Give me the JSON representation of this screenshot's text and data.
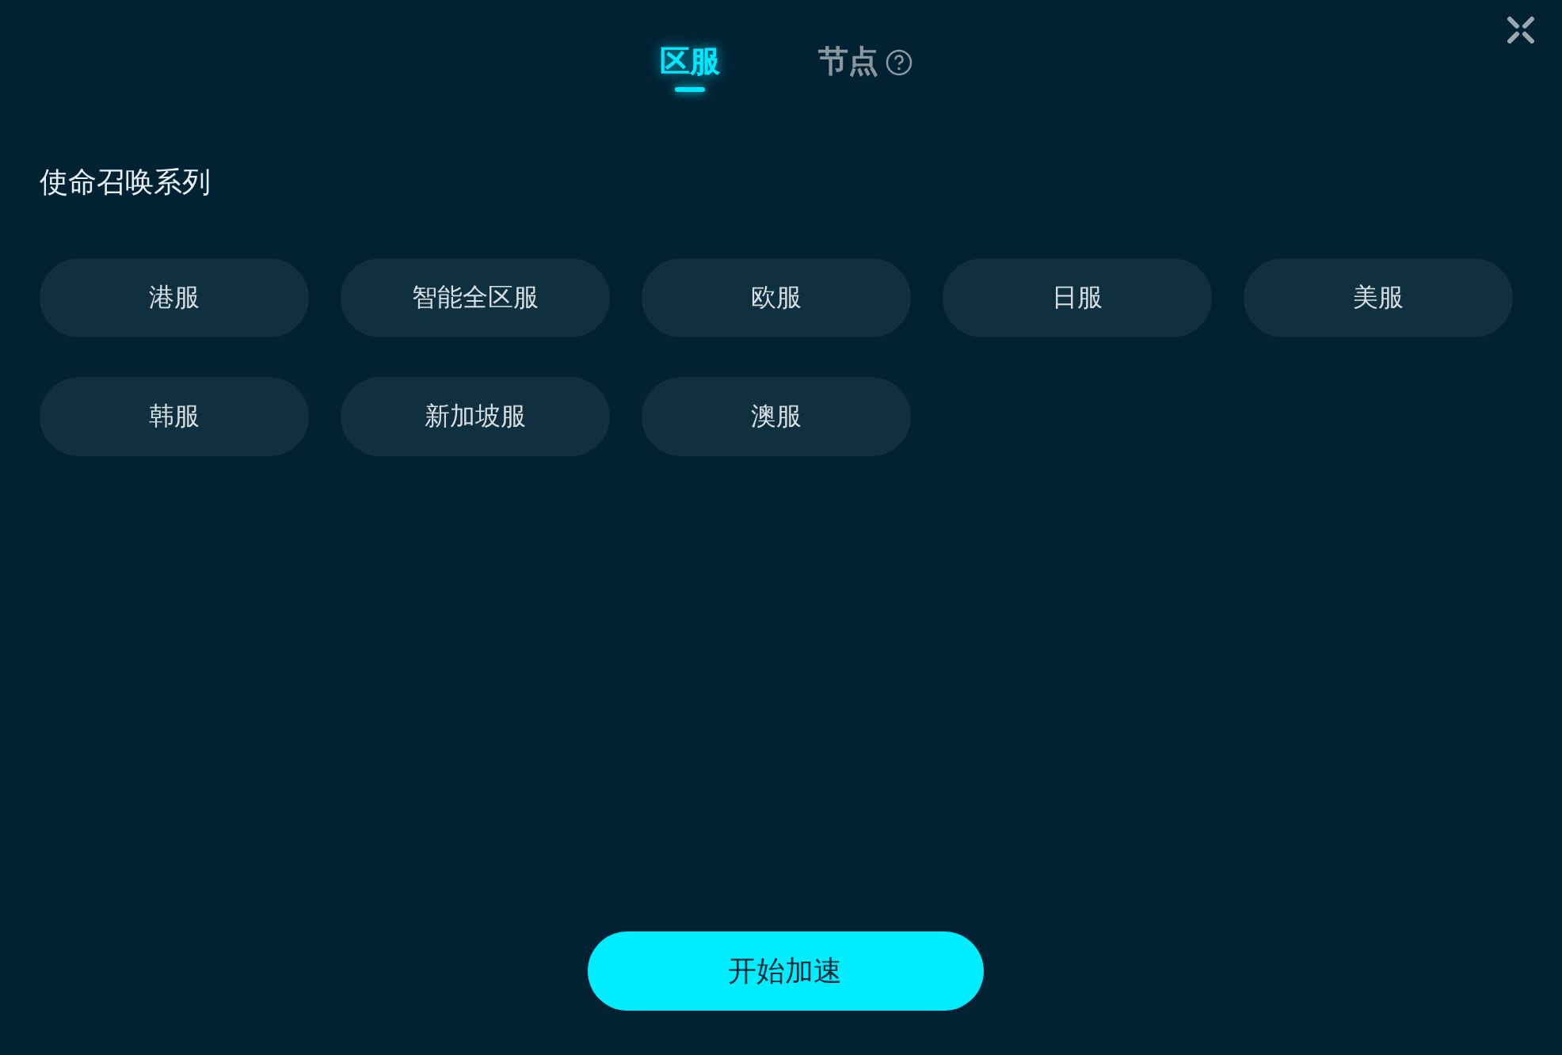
{
  "tabs": [
    {
      "label": "区服",
      "selected": true,
      "help": false
    },
    {
      "label": "节点",
      "selected": false,
      "help": true
    }
  ],
  "section_title": "使命召唤系列",
  "servers": [
    {
      "label": "港服"
    },
    {
      "label": "智能全区服"
    },
    {
      "label": "欧服"
    },
    {
      "label": "日服"
    },
    {
      "label": "美服"
    },
    {
      "label": "韩服"
    },
    {
      "label": "新加坡服"
    },
    {
      "label": "澳服"
    }
  ],
  "start_button": "开始加速"
}
